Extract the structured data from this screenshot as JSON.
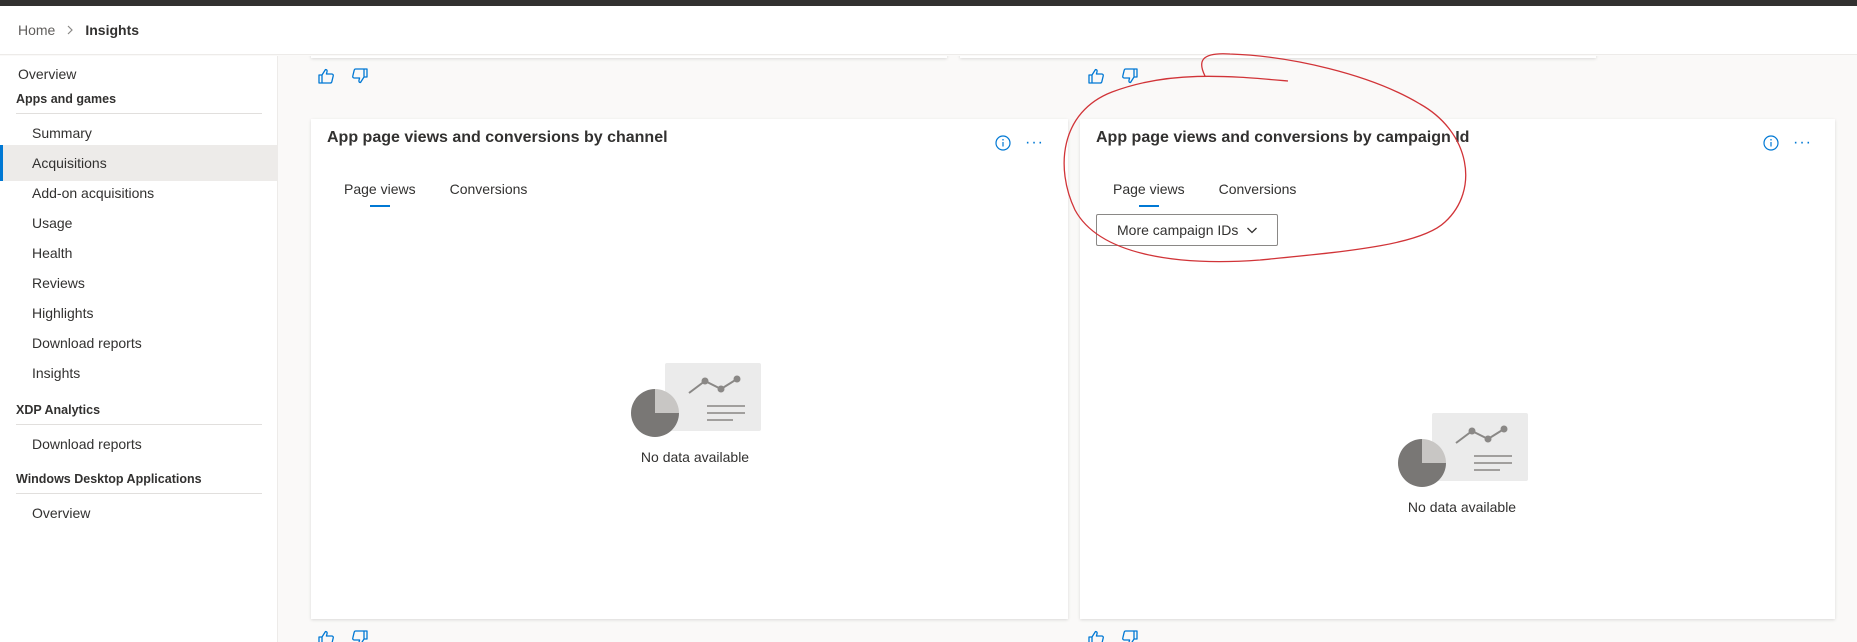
{
  "breadcrumb": {
    "home": "Home",
    "current": "Insights"
  },
  "sidebar": {
    "overview": "Overview",
    "apps_heading": "Apps and games",
    "apps_items": [
      "Summary",
      "Acquisitions",
      "Add-on acquisitions",
      "Usage",
      "Health",
      "Reviews",
      "Highlights",
      "Download reports",
      "Insights"
    ],
    "active_item": "Acquisitions",
    "xdp_heading": "XDP Analytics",
    "xdp_items": [
      "Download reports"
    ],
    "windows_heading": "Windows Desktop Applications",
    "windows_items": [
      "Overview"
    ]
  },
  "cards": {
    "channel": {
      "title": "App page views and conversions by channel",
      "tabs": [
        "Page views",
        "Conversions"
      ],
      "active_tab": "Page views",
      "empty_text": "No data available"
    },
    "campaign": {
      "title": "App page views and conversions by campaign Id",
      "tabs": [
        "Page views",
        "Conversions"
      ],
      "active_tab": "Page views",
      "dropdown_label": "More campaign IDs",
      "empty_text": "No data available"
    }
  },
  "icons": {
    "info": "info-icon",
    "more": "more-options-icon",
    "like": "thumbs-up-icon",
    "dislike": "thumbs-down-icon",
    "chevron": "chevron-down-icon"
  },
  "colors": {
    "accent": "#0078d4",
    "annotation": "#d13438",
    "active_bg": "#edebe9"
  }
}
